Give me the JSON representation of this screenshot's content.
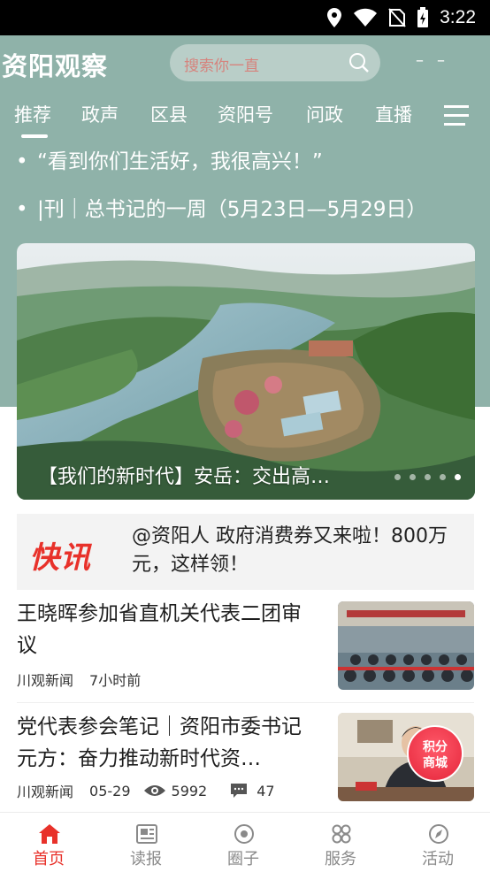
{
  "status_bar": {
    "time": "3:22"
  },
  "header": {
    "logo": "资阳观察",
    "search_placeholder": "搜索你一直",
    "dash_1": "–",
    "dash_2": "–"
  },
  "channels": [
    "推荐",
    "政声",
    "区县",
    "资阳号",
    "问政",
    "直播"
  ],
  "headlines": [
    "“看到你们生活好，我很高兴！”",
    "|刊｜总书记的一周（5月23日—5月29日）"
  ],
  "carousel": {
    "caption": "【我们的新时代】安岳：交出高…",
    "slide_count": 5,
    "active_index": 4
  },
  "flash_news": {
    "logo": "快讯",
    "text": "@资阳人 政府消费券又来啦！800万元，这样领！"
  },
  "news": [
    {
      "title": "王晓晖参加省直机关代表二团审议",
      "source": "川观新闻",
      "time": "7小时前"
    },
    {
      "title": "党代表参会笔记｜资阳市委书记元方：奋力推动新时代资…",
      "source": "川观新闻",
      "time": "05-29",
      "views": "5992",
      "comments": "47"
    }
  ],
  "points_badge": {
    "line1": "积分",
    "line2": "商城"
  },
  "bottom_nav": [
    {
      "label": "首页",
      "icon": "home-icon",
      "active": true
    },
    {
      "label": "读报",
      "icon": "newspaper-icon",
      "active": false
    },
    {
      "label": "圈子",
      "icon": "circle-icon",
      "active": false
    },
    {
      "label": "服务",
      "icon": "grid-icon",
      "active": false
    },
    {
      "label": "活动",
      "icon": "compass-icon",
      "active": false
    }
  ],
  "colors": {
    "header_teal": "#8fb2a9",
    "accent_red": "#e8312a"
  }
}
